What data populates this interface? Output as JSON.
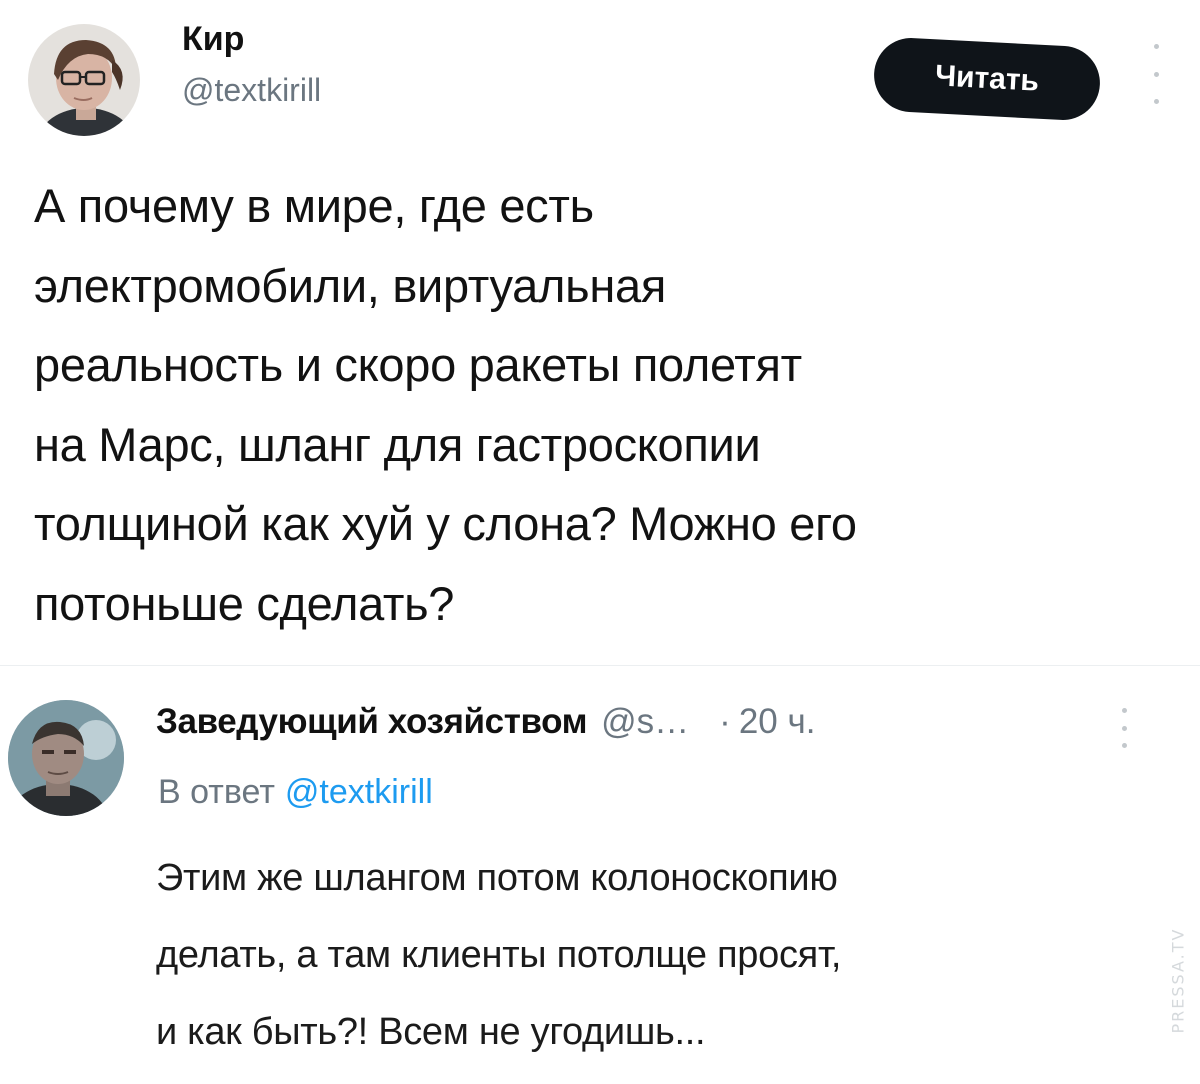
{
  "tweet": {
    "author": {
      "display_name": "Кир",
      "handle": "@textkirill",
      "avatar_icon": "user-avatar-glasses-icon"
    },
    "follow_button_label": "Читать",
    "more_icon": "more-vertical-icon",
    "text_lines": [
      "А почему в мире, где есть",
      "электромобили, виртуальная",
      "реальность и скоро ракеты полетят",
      "на Марс, шланг для гастроскопии",
      "толщиной как хуй у слона? Можно его",
      "потоньше сделать?"
    ]
  },
  "reply": {
    "author": {
      "display_name": "Заведующий хозяйством",
      "handle": "@s…",
      "avatar_icon": "user-avatar-photo-icon"
    },
    "separator": "·",
    "time": "20 ч.",
    "more_icon": "more-vertical-icon",
    "reply_to_prefix": "В ответ",
    "reply_to_handle": "@textkirill",
    "text_lines": [
      "Этим же шлангом потом колоноскопию",
      "делать, а там клиенты потолще просят,",
      "и как быть?! Всем не угодишь..."
    ]
  },
  "watermark": "PRESSA.TV",
  "colors": {
    "background": "#ffffff",
    "text_primary": "#0f1419",
    "text_secondary": "#6b7680",
    "link": "#1d9bf0",
    "button_bg": "#0f1419",
    "button_text": "#ffffff"
  }
}
